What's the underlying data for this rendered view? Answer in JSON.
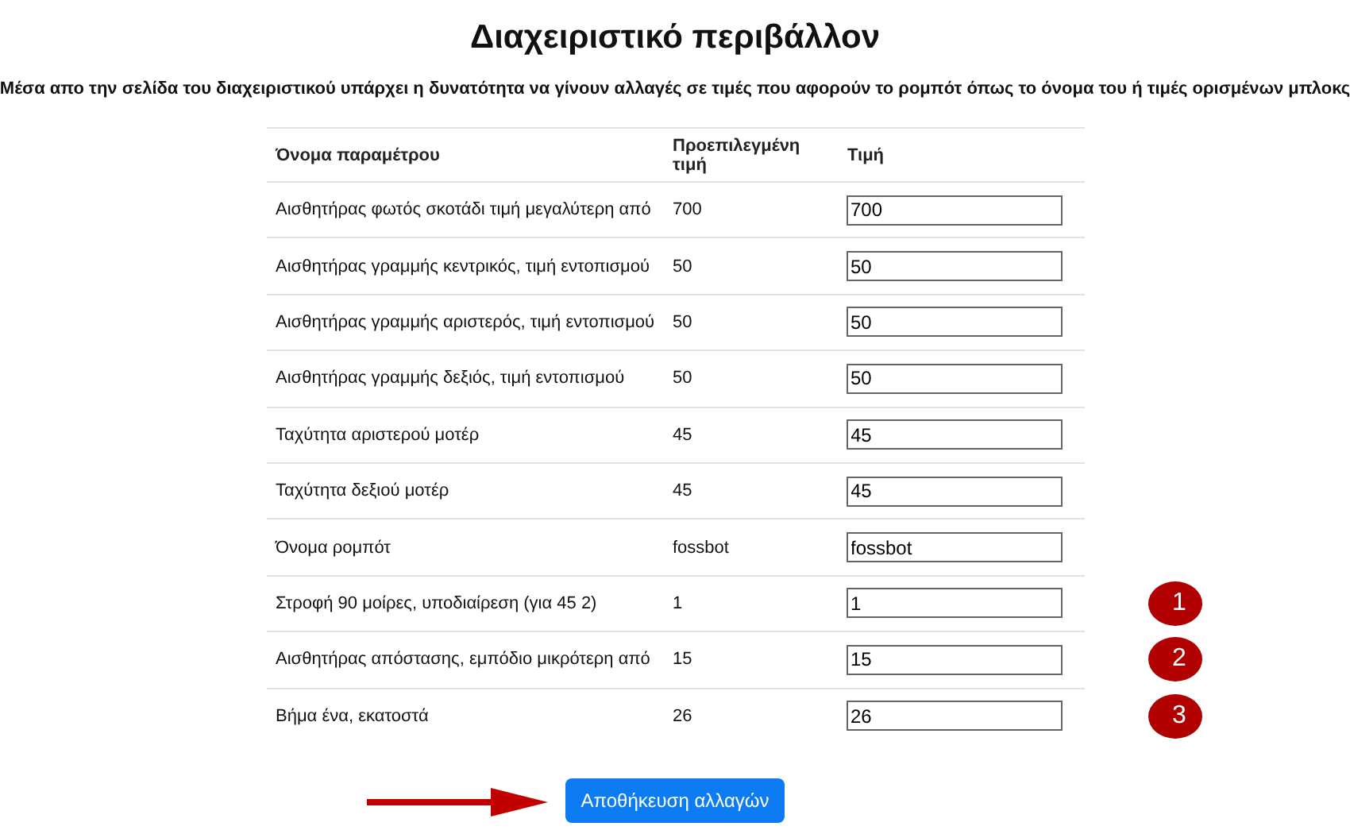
{
  "title": "Διαχειριστικό περιβάλλον",
  "description": "Μέσα απο την σελίδα του διαχειριστικού υπάρχει η δυνατότητα να γίνουν αλλαγές σε τιμές που αφορούν το ρομπότ όπως το όνομα του ή τιμές ορισμένων μπλοκς",
  "table": {
    "columns": [
      "Όνομα παραμέτρου",
      "Προεπιλεγμένη τιμή",
      "Τιμή"
    ],
    "rows": [
      {
        "name": "Αισθητήρας φωτός σκοτάδι τιμή μεγαλύτερη από",
        "default": "700",
        "value": "700"
      },
      {
        "name": "Αισθητήρας γραμμής κεντρικός, τιμή εντοπισμού",
        "default": "50",
        "value": "50"
      },
      {
        "name": "Αισθητήρας γραμμής αριστερός, τιμή εντοπισμού",
        "default": "50",
        "value": "50"
      },
      {
        "name": "Αισθητήρας γραμμής δεξιός, τιμή εντοπισμού",
        "default": "50",
        "value": "50"
      },
      {
        "name": "Ταχύτητα αριστερού μοτέρ",
        "default": "45",
        "value": "45"
      },
      {
        "name": "Ταχύτητα δεξιού μοτέρ",
        "default": "45",
        "value": "45"
      },
      {
        "name": "Όνομα ρομπότ",
        "default": "fossbot",
        "value": "fossbot"
      },
      {
        "name": "Στροφή 90 μοίρες, υποδιαίρεση (για 45 2)",
        "default": "1",
        "value": "1",
        "marker": "1"
      },
      {
        "name": "Αισθητήρας απόστασης, εμπόδιο μικρότερη από",
        "default": "15",
        "value": "15",
        "marker": "2"
      },
      {
        "name": "Βήμα ένα, εκατοστά",
        "default": "26",
        "value": "26",
        "marker": "3"
      }
    ]
  },
  "save_button": "Αποθήκευση αλλαγών"
}
